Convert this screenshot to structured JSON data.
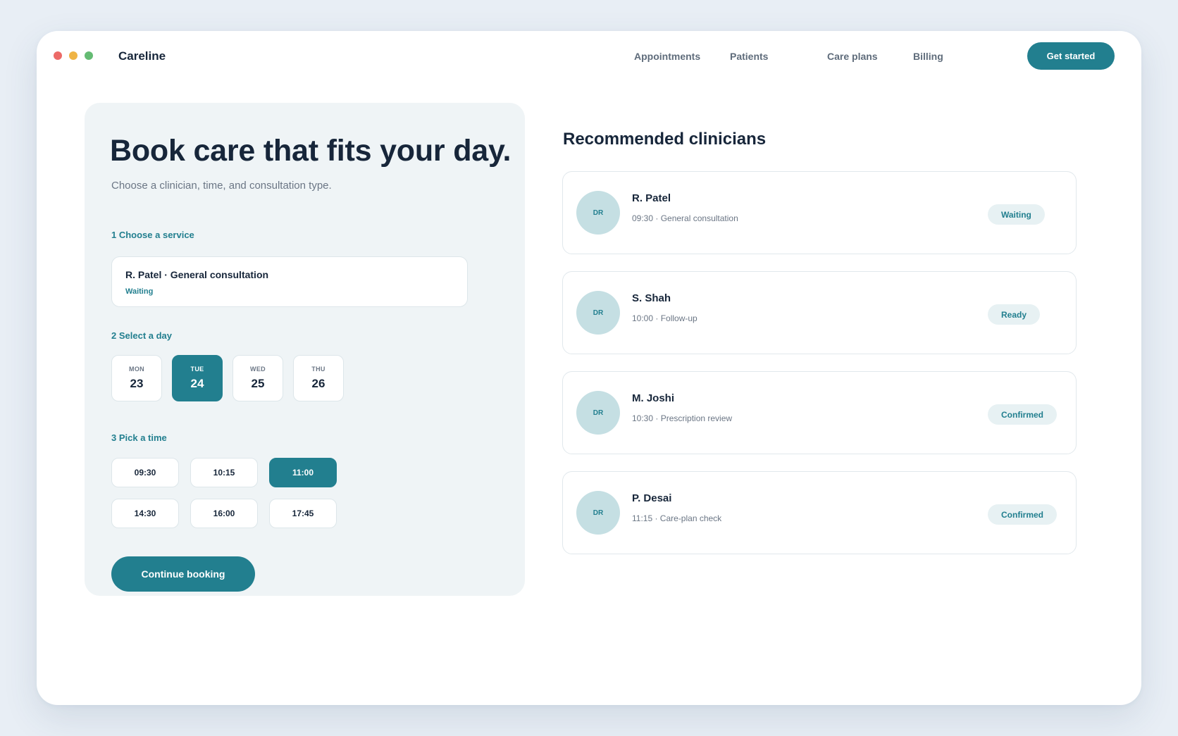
{
  "window": {
    "dots": [
      {
        "name": "close-dot",
        "color": "#ec6a67"
      },
      {
        "name": "minimize-dot",
        "color": "#efb445"
      },
      {
        "name": "maximize-dot",
        "color": "#64bb73"
      }
    ]
  },
  "header": {
    "brand": "Careline",
    "nav": [
      "Appointments",
      "Patients",
      "Care plans",
      "Billing"
    ],
    "cta_label": "Get started"
  },
  "booking": {
    "headline": "Book care that fits your day.",
    "subtitle": "Choose a clinician, time, and consultation type.",
    "step1_label": "1 Choose a service",
    "service": {
      "title": "R. Patel · General consultation",
      "status": "Waiting"
    },
    "step2_label": "2 Select a day",
    "days": [
      {
        "name": "MON",
        "num": "23"
      },
      {
        "name": "TUE",
        "num": "24"
      },
      {
        "name": "WED",
        "num": "25"
      },
      {
        "name": "THU",
        "num": "26"
      }
    ],
    "selected_day": 1,
    "step3_label": "3 Pick a time",
    "times": [
      "09:30",
      "10:15",
      "11:00",
      "14:30",
      "16:00",
      "17:45"
    ],
    "selected_time": 2,
    "continue_label": "Continue booking"
  },
  "recommended": {
    "title": "Recommended clinicians",
    "clinicians": [
      {
        "initials": "DR",
        "name": "R. Patel",
        "meta": "09:30 · General consultation",
        "status": "Waiting"
      },
      {
        "initials": "DR",
        "name": "S. Shah",
        "meta": "10:00 · Follow-up",
        "status": "Ready"
      },
      {
        "initials": "DR",
        "name": "M. Joshi",
        "meta": "10:30 · Prescription review",
        "status": "Confirmed"
      },
      {
        "initials": "DR",
        "name": "P. Desai",
        "meta": "11:15 · Care-plan check",
        "status": "Confirmed"
      }
    ]
  },
  "colors": {
    "accent": "#227f8f",
    "avatar_bg": "#c5dfe3",
    "badge_bg": "#e7f1f3",
    "panel_bg": "#eff4f6"
  }
}
